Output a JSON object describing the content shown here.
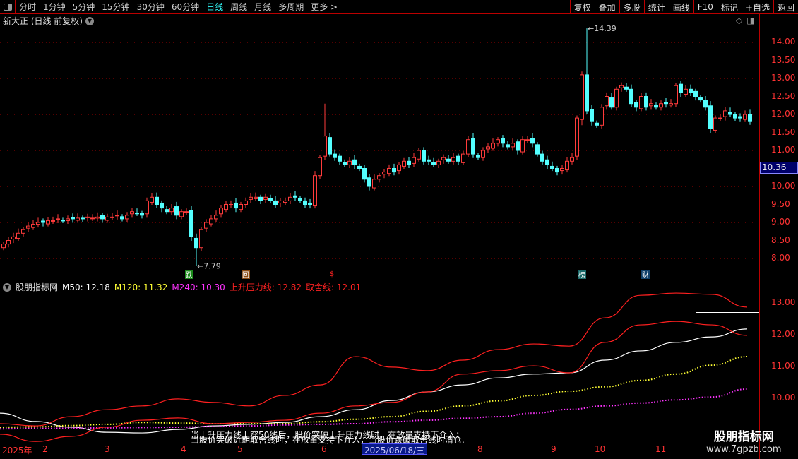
{
  "toolbar": {
    "periods": [
      "分时",
      "1分钟",
      "5分钟",
      "15分钟",
      "30分钟",
      "60分钟",
      "日线",
      "周线",
      "月线",
      "多周期",
      "更多 >"
    ],
    "active": "日线",
    "right": [
      "复权",
      "叠加",
      "多股",
      "统计",
      "画线",
      "F10",
      "标记",
      "+自选",
      "返回"
    ]
  },
  "title": "新大正 (日线 前复权)",
  "indicator": {
    "name": "股朋指标网",
    "m50": "M50: 12.18",
    "m120": "M120: 11.32",
    "m240": "M240: 10.30",
    "pressure": "上升压力线: 12.82",
    "cutoff": "取舍线: 12.01"
  },
  "notes": [
    "当上升压力线上穿50线后，股价突破上升压力线时，在放量支持下介入；",
    "当股价突破近期取舍线时，在放量支持下介入，当股价跌破取舍线时清仓."
  ],
  "watermark": {
    "title": "股朋指标网",
    "url": "www.7gpzb.com"
  },
  "current_price": "10.36",
  "cursor_date": "2025/06/18/三",
  "date_labels": [
    "2025年",
    "2",
    "3",
    "4",
    "5",
    "6",
    "8",
    "9",
    "10",
    "11"
  ],
  "signals": [
    "跌",
    "回",
    "$",
    "榜",
    "财"
  ],
  "colors": {
    "up": "#ff3b3b",
    "down": "#54ffff",
    "m50": "#ffffff",
    "m120": "#ffff33",
    "m240": "#ff33ff",
    "band": "#ff2020"
  },
  "chart_data": {
    "type": "candlestick",
    "price_axis": [
      "14.00",
      "13.50",
      "13.00",
      "12.50",
      "12.00",
      "11.50",
      "11.00",
      "10.00",
      "9.50",
      "9.00",
      "8.50",
      "8.00"
    ],
    "ylim": [
      7.6,
      14.6
    ],
    "high_label": "14.39",
    "low_label": "7.79",
    "closes": [
      8.4,
      8.5,
      8.6,
      8.7,
      8.8,
      8.9,
      8.95,
      9.0,
      9.0,
      9.05,
      9.05,
      9.1,
      9.05,
      9.1,
      9.1,
      9.12,
      9.1,
      9.15,
      9.12,
      9.15,
      9.1,
      9.15,
      9.15,
      9.2,
      9.1,
      9.2,
      9.3,
      9.25,
      9.2,
      9.6,
      9.7,
      9.5,
      9.4,
      9.3,
      9.4,
      9.2,
      9.3,
      9.3,
      8.6,
      8.3,
      8.8,
      9.0,
      9.1,
      9.2,
      9.4,
      9.5,
      9.5,
      9.4,
      9.5,
      9.6,
      9.7,
      9.7,
      9.6,
      9.7,
      9.6,
      9.5,
      9.6,
      9.6,
      9.7,
      9.7,
      9.6,
      9.5,
      9.5,
      10.3,
      10.8,
      11.4,
      10.9,
      10.8,
      10.7,
      10.6,
      10.7,
      10.6,
      10.5,
      10.2,
      10.0,
      10.2,
      10.3,
      10.4,
      10.5,
      10.4,
      10.6,
      10.7,
      10.6,
      10.8,
      11.0,
      10.7,
      10.7,
      10.6,
      10.7,
      10.8,
      10.7,
      10.8,
      10.7,
      10.9,
      11.3,
      10.9,
      10.8,
      11.0,
      11.1,
      11.2,
      11.3,
      11.2,
      11.1,
      11.2,
      11.0,
      11.3,
      11.3,
      11.2,
      10.9,
      10.7,
      10.6,
      10.5,
      10.4,
      10.5,
      10.7,
      10.8,
      11.9,
      13.1,
      12.1,
      11.8,
      11.7,
      12.2,
      12.5,
      12.2,
      12.7,
      12.8,
      12.7,
      12.3,
      12.2,
      12.5,
      12.2,
      12.3,
      12.2,
      12.3,
      12.3,
      12.3,
      12.8,
      12.6,
      12.7,
      12.6,
      12.5,
      12.4,
      12.2,
      11.6,
      11.9,
      11.9,
      12.1,
      12.0,
      11.9,
      11.9,
      12.0,
      11.8
    ],
    "extremes": {
      "39": {
        "l": 7.79
      },
      "65": {
        "h": 12.3
      },
      "118": {
        "h": 14.39
      },
      "117": {
        "l": 11.7
      }
    },
    "indicator_axis": [
      "13.00",
      "12.00",
      "11.00",
      "10.00"
    ],
    "indicator_ylim": [
      8.5,
      13.8
    ],
    "series": [
      {
        "name": "M50",
        "values": [
          9.53,
          9.27,
          9.09,
          8.93,
          8.91,
          9.02,
          9.13,
          9.18,
          9.24,
          9.42,
          9.64,
          9.93,
          10.2,
          10.42,
          10.64,
          10.76,
          10.8,
          11.2,
          11.49,
          11.76,
          11.93,
          12.18
        ]
      },
      {
        "name": "M120",
        "values": [
          9.09,
          9.1,
          9.14,
          9.18,
          9.24,
          9.22,
          9.2,
          9.2,
          9.2,
          9.26,
          9.34,
          9.42,
          9.59,
          9.76,
          9.92,
          10.09,
          10.22,
          10.36,
          10.56,
          10.76,
          11.04,
          11.31
        ]
      },
      {
        "name": "M240",
        "values": [
          9.04,
          9.05,
          9.06,
          9.07,
          9.08,
          9.09,
          9.11,
          9.13,
          9.16,
          9.18,
          9.2,
          9.26,
          9.31,
          9.37,
          9.42,
          9.53,
          9.65,
          9.76,
          9.85,
          9.95,
          10.04,
          10.29
        ]
      },
      {
        "name": "上升压力线",
        "values": [
          9.2,
          9.13,
          9.42,
          9.64,
          9.76,
          9.98,
          9.87,
          9.76,
          10.09,
          10.42,
          11.31,
          10.98,
          10.87,
          11.2,
          11.53,
          11.71,
          11.64,
          12.53,
          13.24,
          13.31,
          13.27,
          12.87
        ]
      },
      {
        "name": "取舍线",
        "values": [
          8.87,
          8.64,
          8.8,
          9.09,
          9.31,
          9.38,
          9.2,
          9.24,
          9.31,
          9.53,
          9.76,
          9.87,
          10.2,
          10.76,
          10.87,
          11.02,
          10.8,
          11.76,
          12.31,
          12.42,
          12.31,
          11.98
        ]
      }
    ],
    "reference_line": 12.7
  }
}
